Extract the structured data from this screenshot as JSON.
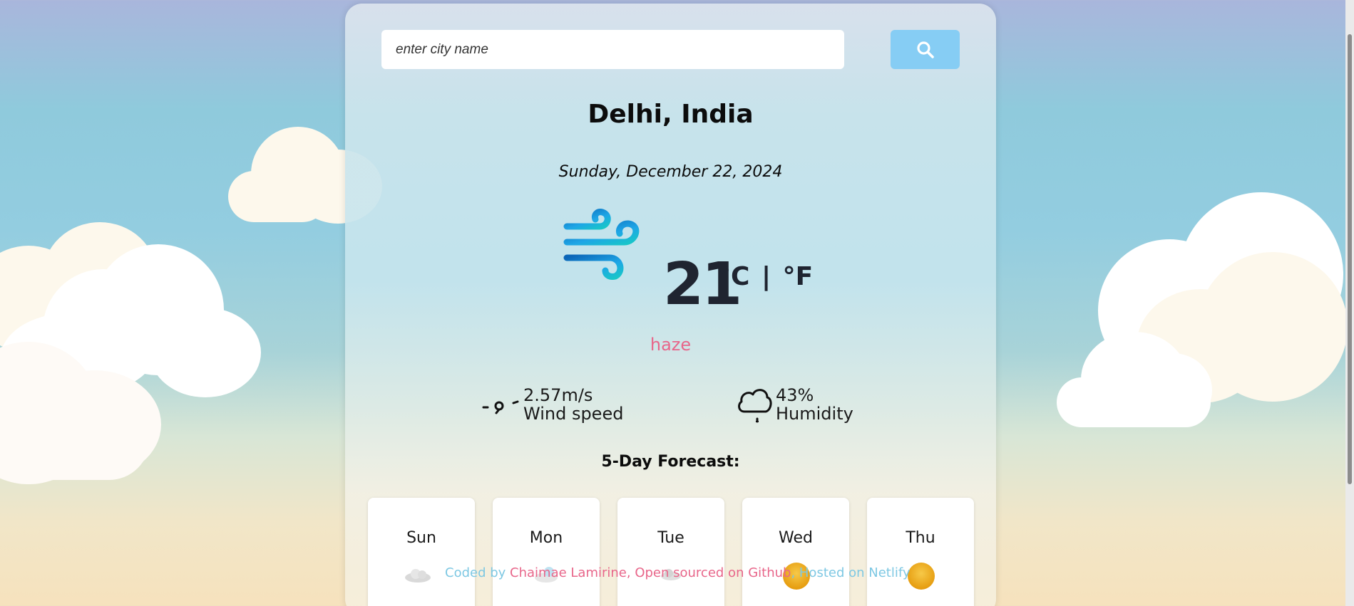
{
  "search": {
    "placeholder": "enter city name",
    "button_icon": "search-icon"
  },
  "location": {
    "city": "Delhi, India",
    "date": "Sunday, December 22, 2024"
  },
  "current": {
    "icon": "wind-icon",
    "temperature": "21",
    "unit_celsius": "°C",
    "unit_separator": "|",
    "unit_fahrenheit": "°F",
    "condition": "haze"
  },
  "stats": {
    "wind": {
      "icon": "wind-speed-icon",
      "value": "2.57m/s",
      "label": "Wind speed"
    },
    "humidity": {
      "icon": "humidity-icon",
      "value": "43%",
      "label": "Humidity"
    }
  },
  "forecast": {
    "title": "5-Day Forecast:",
    "days": [
      {
        "day": "Sun",
        "icon": "cloud-icon"
      },
      {
        "day": "Mon",
        "icon": "cloud-icon"
      },
      {
        "day": "Tue",
        "icon": "cloud-icon"
      },
      {
        "day": "Wed",
        "icon": "sun-icon"
      },
      {
        "day": "Thu",
        "icon": "sun-icon"
      }
    ]
  },
  "footer": {
    "prefix": "Coded by ",
    "author": "Chaimae Lamirine",
    "middle": ", Open sourced on ",
    "github": "Github",
    "suffix": ", Hosted on Netlify"
  },
  "colors": {
    "accent": "#86cdf4",
    "condition": "#e8668a",
    "footer_text": "#7ec8e3"
  }
}
